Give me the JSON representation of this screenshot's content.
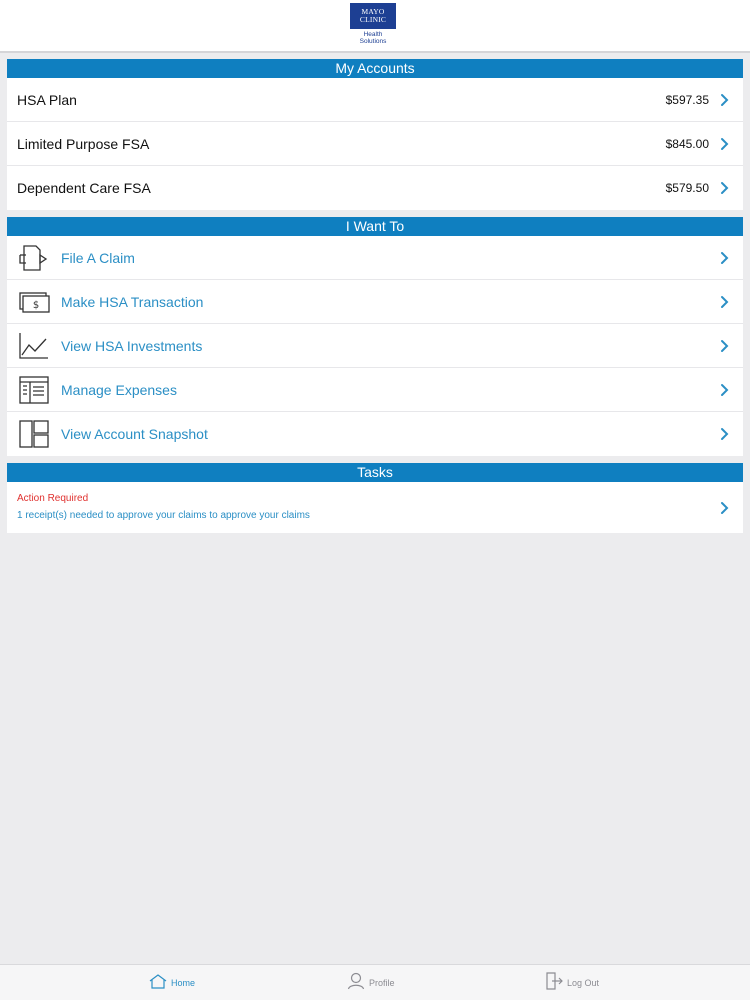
{
  "header": {
    "logo": {
      "line1": "MAYO",
      "line2": "CLINIC",
      "sub1": "Health",
      "sub2": "Solutions",
      "brand_color": "#1d3f93"
    }
  },
  "accounts": {
    "title": "My Accounts",
    "items": [
      {
        "label": "HSA Plan",
        "value": "$597.35"
      },
      {
        "label": "Limited Purpose FSA",
        "value": "$845.00"
      },
      {
        "label": "Dependent Care FSA",
        "value": "$579.50"
      }
    ]
  },
  "want": {
    "title": "I Want To",
    "items": [
      {
        "label": "File A Claim",
        "icon": "file-claim-icon"
      },
      {
        "label": "Make HSA Transaction",
        "icon": "dollar-bill-icon"
      },
      {
        "label": "View HSA Investments",
        "icon": "line-chart-icon"
      },
      {
        "label": "Manage Expenses",
        "icon": "document-list-icon"
      },
      {
        "label": "View Account Snapshot",
        "icon": "layout-panels-icon"
      }
    ]
  },
  "tasks": {
    "title": "Tasks",
    "item": {
      "status": "Action Required",
      "description": "1 receipt(s) needed to approve your claims to approve your claims"
    }
  },
  "tabbar": {
    "home": "Home",
    "profile": "Profile",
    "logout": "Log Out"
  },
  "colors": {
    "section_header": "#0f7fc0",
    "link": "#2b8fc5",
    "alert": "#e0312f",
    "background": "#ececee"
  }
}
